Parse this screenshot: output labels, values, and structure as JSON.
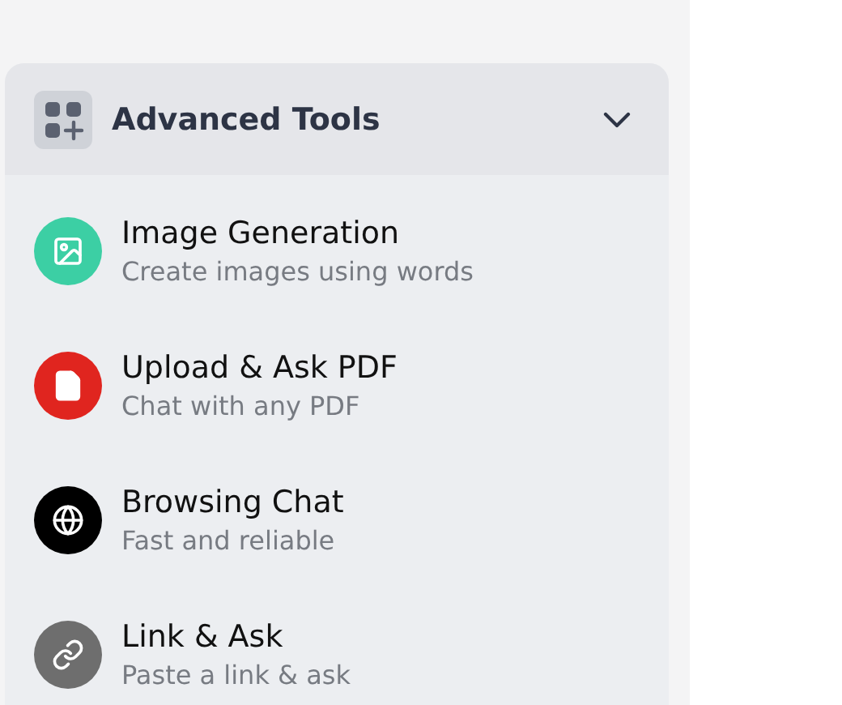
{
  "panel": {
    "title": "Advanced Tools",
    "expanded": true,
    "items": [
      {
        "kind": "image",
        "color": "#3ccfa4",
        "title": "Image Generation",
        "subtitle": "Create images using words"
      },
      {
        "kind": "file",
        "color": "#e0251f",
        "title": "Upload & Ask PDF",
        "subtitle": "Chat with any PDF"
      },
      {
        "kind": "globe",
        "color": "#000000",
        "title": "Browsing Chat",
        "subtitle": "Fast and reliable"
      },
      {
        "kind": "link",
        "color": "#6e6e6e",
        "title": "Link & Ask",
        "subtitle": "Paste a link & ask"
      }
    ]
  }
}
